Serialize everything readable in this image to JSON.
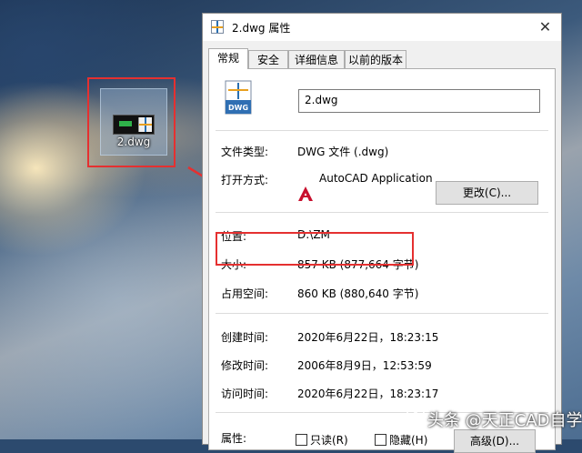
{
  "desktop": {
    "file_label": "2.dwg"
  },
  "dialog": {
    "title": "2.dwg 属性",
    "close_glyph": "✕",
    "tabs": [
      {
        "label": "常规",
        "active": true
      },
      {
        "label": "安全",
        "active": false
      },
      {
        "label": "详细信息",
        "active": false
      },
      {
        "label": "以前的版本",
        "active": false
      }
    ],
    "file_name_value": "2.dwg",
    "file_icon_text": "DWG",
    "rows": {
      "type": {
        "label": "文件类型:",
        "value": "DWG 文件 (.dwg)"
      },
      "opens_with": {
        "label": "打开方式:",
        "value": "AutoCAD Application",
        "button": "更改(C)..."
      },
      "location": {
        "label": "位置:",
        "value": "D:\\ZM"
      },
      "size": {
        "label": "大小:",
        "value": "857 KB (877,664 字节)"
      },
      "size_on_disk": {
        "label": "占用空间:",
        "value": "860 KB (880,640 字节)"
      },
      "created": {
        "label": "创建时间:",
        "value": "2020年6月22日，18:23:15"
      },
      "modified": {
        "label": "修改时间:",
        "value": "2006年8月9日，12:53:59"
      },
      "accessed": {
        "label": "访问时间:",
        "value": "2020年6月22日，18:23:17"
      },
      "attributes": {
        "label": "属性:",
        "readonly": "只读(R)",
        "hidden": "隐藏(H)",
        "advanced_button": "高级(D)..."
      }
    }
  },
  "watermark": "头条 @天正CAD自学",
  "colors": {
    "highlight_red": "#e53030",
    "autocad_red": "#c8102e"
  }
}
